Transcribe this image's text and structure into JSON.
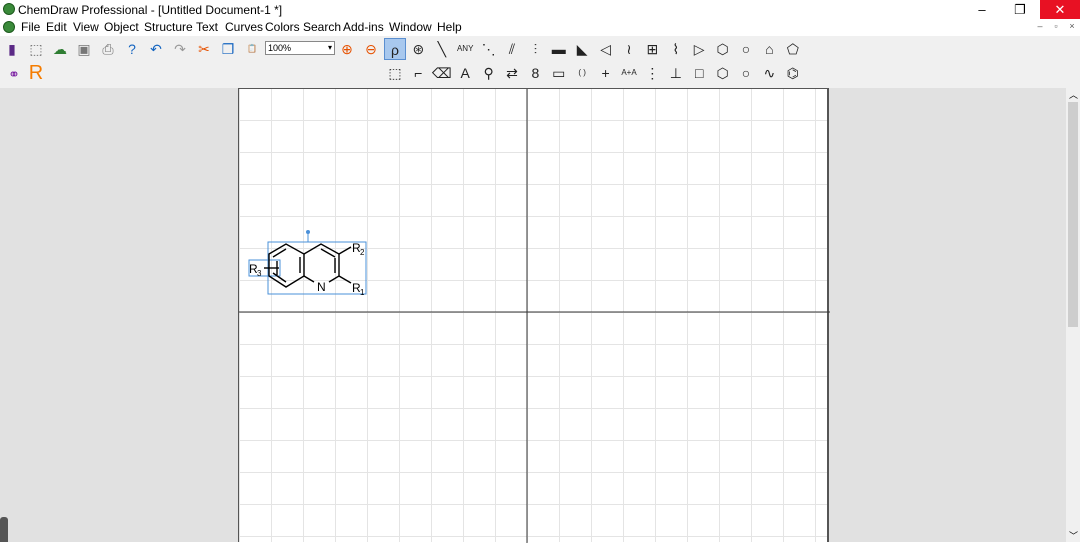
{
  "window": {
    "title": "ChemDraw Professional - [Untitled Document-1 *]",
    "minimize": "–",
    "restore": "❐",
    "close": "✕"
  },
  "menu": [
    "File",
    "Edit",
    "View",
    "Object",
    "Structure",
    "Text",
    "Curves",
    "Colors",
    "Search",
    "Add-ins",
    "Window",
    "Help"
  ],
  "mdi": {
    "minimize": "–",
    "restore": "▫",
    "close": "×"
  },
  "toolbar1": [
    {
      "name": "new-document",
      "g": "▮",
      "c": "#5b2a86"
    },
    {
      "name": "open",
      "g": "⬚",
      "c": "#666"
    },
    {
      "name": "chemdraw-cloud",
      "g": "☁",
      "c": "#2e7d32"
    },
    {
      "name": "save",
      "g": "▣",
      "c": "#777"
    },
    {
      "name": "print",
      "g": "⎙",
      "c": "#777"
    },
    {
      "name": "help",
      "g": "?",
      "c": "#1565c0"
    },
    {
      "name": "undo",
      "g": "↶",
      "c": "#1565c0"
    },
    {
      "name": "redo",
      "g": "↷",
      "c": "#999"
    },
    {
      "name": "cut",
      "g": "✂",
      "c": "#e65100"
    },
    {
      "name": "copy",
      "g": "❐",
      "c": "#1565c0"
    },
    {
      "name": "paste",
      "g": "📋",
      "c": "#1565c0"
    }
  ],
  "zoom": {
    "value": "100%"
  },
  "toolbar1b": [
    {
      "name": "zoom-in",
      "g": "⊕",
      "c": "#e65100"
    },
    {
      "name": "zoom-out",
      "g": "⊖",
      "c": "#e65100"
    }
  ],
  "tools_row1": [
    {
      "name": "lasso",
      "g": "ρ"
    },
    {
      "name": "structure-perspective",
      "g": "⊛"
    },
    {
      "name": "solid-bond",
      "g": "╲"
    },
    {
      "name": "any-bond",
      "g": "ANY"
    },
    {
      "name": "dashed-bond",
      "g": "⋱"
    },
    {
      "name": "hashed-bond",
      "g": "⫽"
    },
    {
      "name": "hashed-wedge-bond",
      "g": "⫶"
    },
    {
      "name": "bold-bond",
      "g": "▬"
    },
    {
      "name": "wedge-bond",
      "g": "◣"
    },
    {
      "name": "hollow-wedge-bond",
      "g": "◁"
    },
    {
      "name": "wavy-bond",
      "g": "≀"
    },
    {
      "name": "table",
      "g": "⊞"
    },
    {
      "name": "chain",
      "g": "⌇"
    },
    {
      "name": "triangle-ring",
      "g": "▷"
    },
    {
      "name": "hexagon-ring",
      "g": "⬡"
    },
    {
      "name": "heptagon-ring",
      "g": "○"
    },
    {
      "name": "cyclohexane-chair",
      "g": "⌂"
    },
    {
      "name": "cyclopentadiene-ring",
      "g": "⬠"
    }
  ],
  "tools_row2": [
    {
      "name": "marquee",
      "g": "⬚"
    },
    {
      "name": "reaction-mapping",
      "g": "⌐"
    },
    {
      "name": "eraser",
      "g": "⌫"
    },
    {
      "name": "text",
      "g": "A"
    },
    {
      "name": "template",
      "g": "⚲"
    },
    {
      "name": "arrow",
      "g": "⇄"
    },
    {
      "name": "orbital",
      "g": "8"
    },
    {
      "name": "drawing-elements",
      "g": "▭"
    },
    {
      "name": "brackets",
      "g": "( )"
    },
    {
      "name": "chemical-symbols",
      "g": "+"
    },
    {
      "name": "query",
      "g": "A+A"
    },
    {
      "name": "tlc-plate",
      "g": "⋮"
    },
    {
      "name": "stamp",
      "g": "⊥"
    },
    {
      "name": "square-ring",
      "g": "□"
    },
    {
      "name": "hexagon-ring-2",
      "g": "⬡"
    },
    {
      "name": "octagon-ring",
      "g": "○"
    },
    {
      "name": "cyclohexane-boat",
      "g": "∿"
    },
    {
      "name": "benzene-ring",
      "g": "⌬"
    }
  ],
  "structure": {
    "atoms": {
      "N": "N",
      "R1": "R",
      "R1sub": "1",
      "R2": "R",
      "R2sub": "2",
      "R3": "R",
      "R3sub": "3"
    }
  },
  "colors": {
    "selection": "#4a90d9",
    "accent_r": "#f57c00"
  }
}
